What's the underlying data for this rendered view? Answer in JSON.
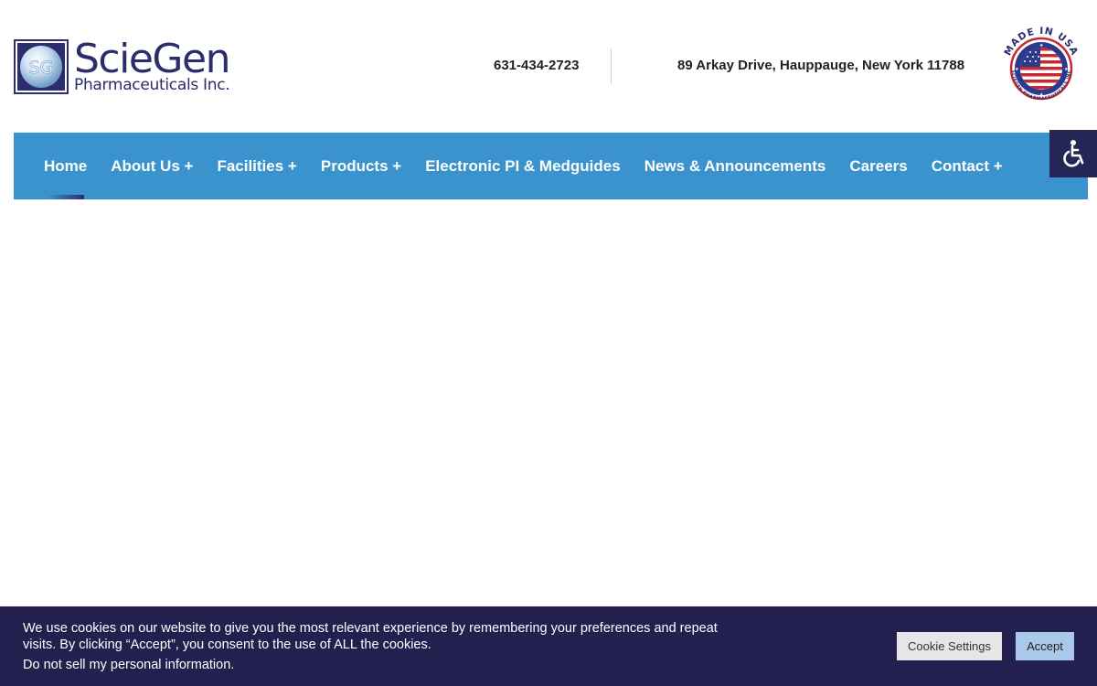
{
  "header": {
    "logo": {
      "mark_text": "SG",
      "name": "ScieGen",
      "subtitle": "Pharmaceuticals Inc."
    },
    "phone": "631-434-2723",
    "address": "89 Arkay Drive, Hauppauge, New York 11788",
    "badge": {
      "top_text": "MADE IN USA",
      "bottom_text": "SCIEGEN PHARMACEUTICALS INC"
    }
  },
  "nav": {
    "active_index": 0,
    "items": [
      {
        "label": "Home"
      },
      {
        "label": "About Us +"
      },
      {
        "label": "Facilities +"
      },
      {
        "label": "Products +"
      },
      {
        "label": "Electronic PI & Medguides"
      },
      {
        "label": "News & Announcements"
      },
      {
        "label": "Careers"
      },
      {
        "label": "Contact +"
      }
    ]
  },
  "accessibility": {
    "icon": "wheelchair-icon"
  },
  "cookie_banner": {
    "message": "We use cookies on our website to give you the most relevant experience by remembering your preferences and repeat visits. By clicking “Accept”, you consent to the use of ALL the cookies.",
    "do_not_sell": "Do not sell my personal information.",
    "settings_label": "Cookie Settings",
    "accept_label": "Accept"
  },
  "colors": {
    "brand_navy": "#2b2d6e",
    "nav_blue": "#3a93cc",
    "banner_bg": "#23204f",
    "accept_bg": "#a9c8ea",
    "badge_red": "#c8282e"
  }
}
